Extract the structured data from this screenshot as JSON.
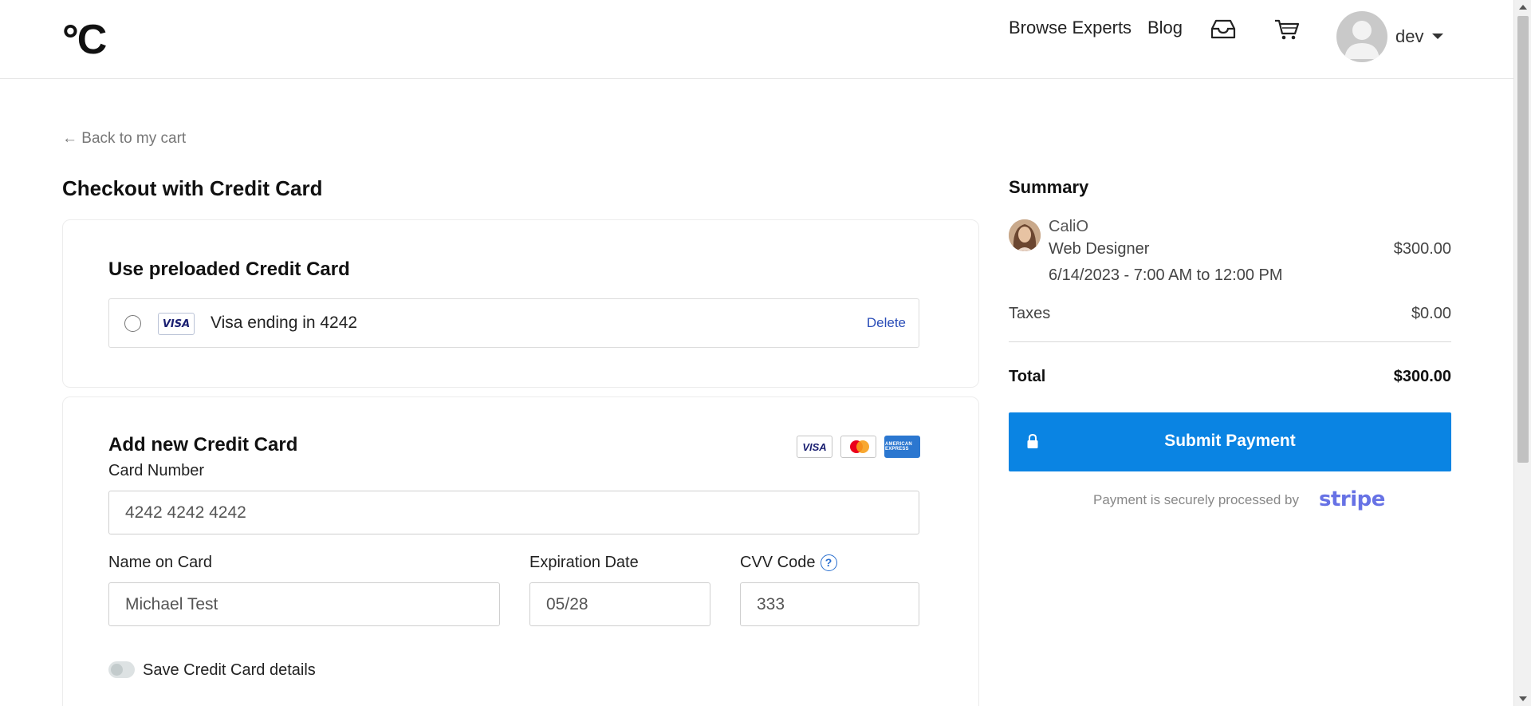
{
  "header": {
    "logo_text": "°C",
    "nav": {
      "browse_experts": "Browse Experts",
      "blog": "Blog"
    },
    "icons": {
      "inbox": "inbox-icon",
      "cart": "cart-icon",
      "caret": "caret-down-icon"
    },
    "user": {
      "name": "dev"
    }
  },
  "page": {
    "back_link": "← Back to my cart",
    "title": "Checkout with Credit Card"
  },
  "preloaded": {
    "title": "Use preloaded Credit Card",
    "card_brand": "VISA",
    "card_label": "Visa ending in 4242",
    "delete_label": "Delete",
    "selected": false
  },
  "new_card": {
    "title": "Add new Credit Card",
    "accepted_brands": [
      "VISA",
      "MasterCard",
      "AMERICAN EXPRESS"
    ],
    "card_number": {
      "label": "Card Number",
      "value": "4242 4242 4242"
    },
    "name_on_card": {
      "label": "Name on Card",
      "value": "Michael Test"
    },
    "expiration": {
      "label": "Expiration Date",
      "value": "05/28"
    },
    "cvv": {
      "label": "CVV Code",
      "value": "333",
      "help": "?"
    },
    "save_toggle": {
      "label": "Save Credit Card details",
      "on": false
    }
  },
  "summary": {
    "title": "Summary",
    "expert": {
      "name": "CaliO",
      "role": "Web Designer",
      "price": "$300.00",
      "time": "6/14/2023 - 7:00 AM to 12:00 PM"
    },
    "taxes": {
      "label": "Taxes",
      "value": "$0.00"
    },
    "total": {
      "label": "Total",
      "value": "$300.00"
    },
    "submit_label": "Submit Payment",
    "secure_text": "Payment is securely processed by",
    "processor": "stripe"
  },
  "colors": {
    "primary_button": "#0a84e3",
    "stripe": "#6772e5",
    "link": "#2a4db8"
  }
}
